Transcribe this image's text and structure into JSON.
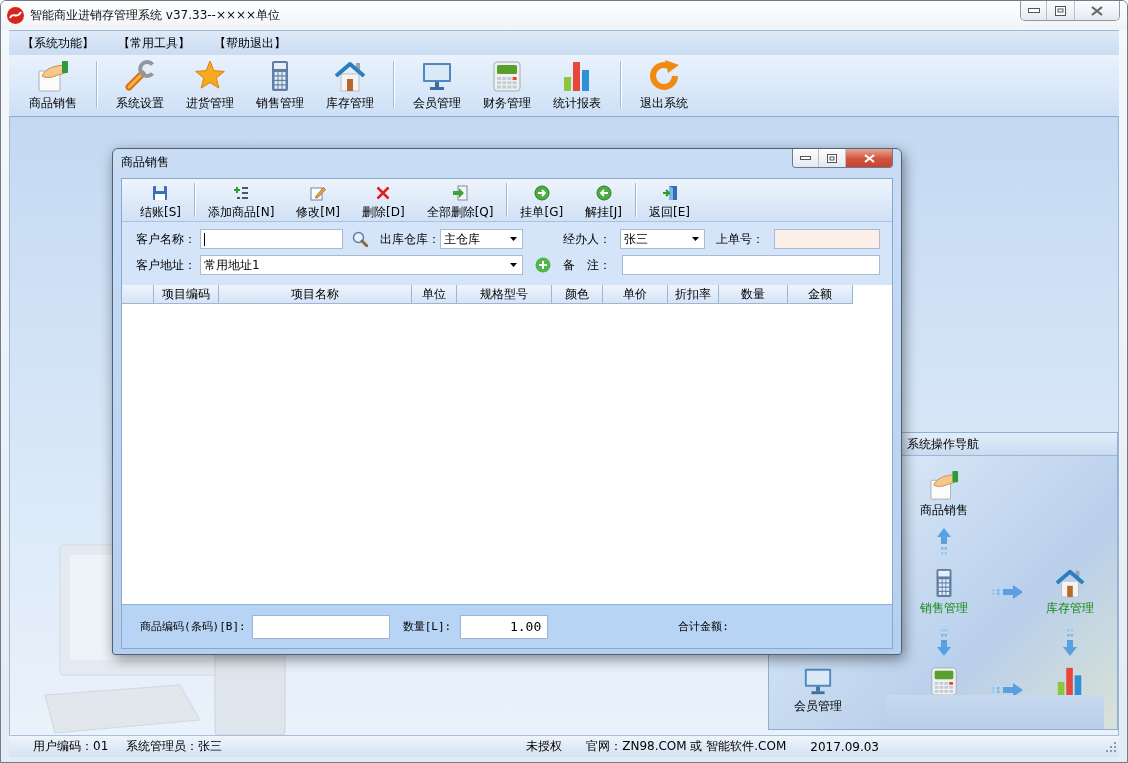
{
  "window": {
    "title": "智能商业进销存管理系统 v37.33--××××单位"
  },
  "menu": [
    "【系统功能】",
    "【常用工具】",
    "【帮助退出】"
  ],
  "toolbar": [
    [
      {
        "label": "商品销售",
        "kind": "hand"
      }
    ],
    [
      {
        "label": "系统设置",
        "kind": "wrench"
      },
      {
        "label": "进货管理",
        "kind": "star"
      },
      {
        "label": "销售管理",
        "kind": "calculator"
      },
      {
        "label": "库存管理",
        "kind": "house"
      }
    ],
    [
      {
        "label": "会员管理",
        "kind": "monitor"
      },
      {
        "label": "财务管理",
        "kind": "register"
      },
      {
        "label": "统计报表",
        "kind": "chart"
      }
    ],
    [
      {
        "label": "退出系统",
        "kind": "refresh"
      }
    ]
  ],
  "dialog": {
    "title": "商品销售",
    "toolbar": [
      [
        {
          "label": "结账[S]",
          "kind": "save"
        }
      ],
      [
        {
          "label": "添加商品[N]",
          "kind": "add"
        },
        {
          "label": "修改[M]",
          "kind": "edit"
        },
        {
          "label": "删除[D]",
          "kind": "delete"
        },
        {
          "label": "全部删除[Q]",
          "kind": "import"
        }
      ],
      [
        {
          "label": "挂单[G]",
          "kind": "hold"
        },
        {
          "label": "解挂[J]",
          "kind": "release"
        }
      ],
      [
        {
          "label": "返回[E]",
          "kind": "exit"
        }
      ]
    ],
    "fields": {
      "customer_name": {
        "label": "客户名称：",
        "focused": true
      },
      "warehouse": {
        "label": "出库仓库：",
        "value": "主仓库"
      },
      "handler": {
        "label": "经办人：",
        "value": "张三"
      },
      "previous_order": {
        "label": "上单号：",
        "readonly": true
      },
      "customer_address": {
        "label": "客户地址：",
        "value": "常用地址1"
      },
      "remark": {
        "label": "备　注："
      }
    },
    "table": {
      "columns": [
        "项目编码",
        "项目名称",
        "单位",
        "规格型号",
        "颜色",
        "单价",
        "折扣率",
        "数量",
        "金额"
      ]
    },
    "footer": {
      "barcode": {
        "label": "商品编码(条码)[B]:"
      },
      "quantity": {
        "label": "数量[L]:",
        "value": "1.00"
      },
      "total": {
        "label": "合计金额:"
      }
    }
  },
  "nav": {
    "title": "系统操作导航",
    "nodes": [
      {
        "label": "商品销售",
        "kind": "hand",
        "highlighted": false
      },
      {
        "label": "销售管理",
        "kind": "calculator",
        "highlighted": true
      },
      {
        "label": "库存管理",
        "kind": "house",
        "highlighted": true
      },
      {
        "label": "会员管理",
        "kind": "monitor",
        "highlighted": false
      },
      {
        "kind": "register"
      },
      {
        "kind": "chart"
      }
    ]
  },
  "status_bar": {
    "user_code": "用户编码：01",
    "operator": "系统管理员：张三",
    "license": "未授权",
    "website": "官网：ZN98.COM 或 智能软件.COM",
    "date": "2017.09.03"
  }
}
